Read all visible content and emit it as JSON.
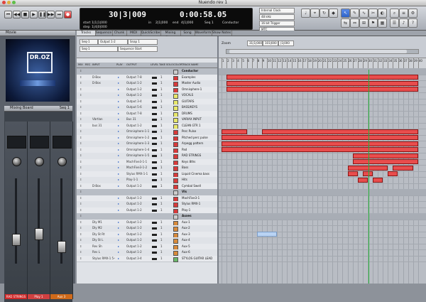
{
  "window": {
    "title": "Nuendo rev 1"
  },
  "transport": {
    "bars": "30|3|009",
    "time": "0:00:58.05",
    "start_label": "start",
    "start_value": "1|1|1|000",
    "step_label": "step",
    "step_value": "1|4|0|000",
    "in_label": "in",
    "in_value": "2|1|000",
    "end_label": "end",
    "end_value": "4|1|000",
    "tempo_label": "Seq 1",
    "conductor": "Conductor",
    "sync_options": [
      "Internal Clock",
      "48 kHz",
      "16 bit Trigger",
      "MTC"
    ]
  },
  "left": {
    "panel_title": "Movie",
    "logo_text": "DR.OZ",
    "mixer_title": "Mixing Board",
    "mixer_sel": "Seq 1",
    "channels": [
      {
        "name": "RAD STRINGS",
        "color": "#d02a2a"
      },
      {
        "name": "Play 1",
        "color": "#d04040"
      },
      {
        "name": "Aux 3",
        "color": "#d06a1a"
      }
    ]
  },
  "tabs": [
    "Tracks",
    "Sequence",
    "Chunk",
    "MIDI",
    "QuickScribe",
    "Mixing Board",
    "Song",
    "Waveform",
    "Show Notes"
  ],
  "tracklist": {
    "sequence_selector": "Seq-1",
    "track_filter": "Output 1-2",
    "snap": "Snap 1",
    "sequence_start": "Sequence Start",
    "columns": [
      "MIX",
      "REC",
      "INPUT",
      "PLAY",
      "OUTPUT",
      "LEVEL",
      "TAKE",
      "SOLO",
      "COLOR",
      "TRACK NAME"
    ],
    "rows": [
      {
        "input": "",
        "output": "",
        "name": "Conductor",
        "color": "#cccccc"
      },
      {
        "input": "D-Box",
        "output": "Output 7-8",
        "name": "Examples",
        "color": "#d83a3a"
      },
      {
        "input": "D-Box",
        "output": "Output 1-2",
        "name": "Master Audio",
        "color": "#d83a3a"
      },
      {
        "input": "",
        "output": "Output 1-2",
        "name": "Omnisphere-1",
        "color": "#d83a3a"
      },
      {
        "input": "",
        "output": "Output 1-2",
        "name": "VOCALS",
        "color": "#e8e86a"
      },
      {
        "input": "",
        "output": "Output 3-4",
        "name": "GUITARS",
        "color": "#e8e86a"
      },
      {
        "input": "",
        "output": "Output 5-6",
        "name": "BASS/KEYS",
        "color": "#e8e86a"
      },
      {
        "input": "",
        "output": "Output 7-8",
        "name": "DRUMS",
        "color": "#e8e86a"
      },
      {
        "input": "Vbrtlan",
        "output": "Bus 31",
        "name": "VARIAX INPUT",
        "color": "#e8e86a"
      },
      {
        "input": "bus 31",
        "output": "Output 1-2",
        "name": "CLEAN GTR 1",
        "color": "#e8e86a"
      },
      {
        "input": "",
        "output": "Omnisphere-1-1",
        "name": "Perc Pulse",
        "color": "#d83a3a"
      },
      {
        "input": "",
        "output": "Omnisphere-1-2",
        "name": "Pitched perc pulse",
        "color": "#d83a3a"
      },
      {
        "input": "",
        "output": "Omnisphere-1-3",
        "name": "Arpegg pattern",
        "color": "#d83a3a"
      },
      {
        "input": "",
        "output": "Omnisphere-1-4",
        "name": "Pad",
        "color": "#d83a3a"
      },
      {
        "input": "",
        "output": "Omnisphere-1-5",
        "name": "RAD STRINGS",
        "color": "#d83a3a"
      },
      {
        "input": "",
        "output": "MachFive3-1-1",
        "name": "Keys 8ths",
        "color": "#d83a3a"
      },
      {
        "input": "",
        "output": "MachFive3-1-2",
        "name": "Bass",
        "color": "#d83a3a"
      },
      {
        "input": "",
        "output": "Stylus RMX-1-1",
        "name": "Liquid Cinema bass",
        "color": "#d83a3a"
      },
      {
        "input": "",
        "output": "Play-1-1",
        "name": "Hits",
        "color": "#d83a3a"
      },
      {
        "input": "D-Box",
        "output": "Output 1-2",
        "name": "Cymbal Swell",
        "color": "#d83a3a"
      },
      {
        "input": "",
        "output": "",
        "name": "VIs",
        "color": "#cccccc"
      },
      {
        "input": "",
        "output": "Output 1-2",
        "name": "MachFive3-1",
        "color": "#d83a3a"
      },
      {
        "input": "",
        "output": "Output 1-2",
        "name": "Stylus RMX-1",
        "color": "#d83a3a"
      },
      {
        "input": "",
        "output": "Output 1-2",
        "name": "Play-1",
        "color": "#d83a3a"
      },
      {
        "input": "",
        "output": "",
        "name": "Auxes",
        "color": "#cccccc"
      },
      {
        "input": "Dly M1",
        "output": "Output 1-2",
        "name": "Aux-1",
        "color": "#d88a3a"
      },
      {
        "input": "Dly M2",
        "output": "Output 1-2",
        "name": "Aux-2",
        "color": "#d88a3a"
      },
      {
        "input": "Dly St Rt",
        "output": "Output 1-2",
        "name": "Aux-3",
        "color": "#d88a3a"
      },
      {
        "input": "Dly St L",
        "output": "Output 1-2",
        "name": "Aux-4",
        "color": "#d88a3a"
      },
      {
        "input": "Rev Sh",
        "output": "Output 1-2",
        "name": "Aux-5",
        "color": "#d88a3a"
      },
      {
        "input": "Rev L",
        "output": "Output 1-2",
        "name": "Aux-6",
        "color": "#d88a3a"
      },
      {
        "input": "Stylus RMX-1 5-6",
        "output": "Output 3-4",
        "name": "STYLOS GUITAR LEAD",
        "color": "#6ab86a"
      }
    ]
  },
  "arrange": {
    "zoom": "Zoom",
    "cursor_field": "31|1|000",
    "len_field": "101|000",
    "end_field": "|1|000",
    "ruler_labels": [
      "1",
      "2",
      "3",
      "4",
      "5",
      "6",
      "7",
      "8",
      "9",
      "10",
      "11",
      "12",
      "13",
      "14",
      "15",
      "16",
      "17",
      "18",
      "19",
      "20",
      "21",
      "22",
      "23",
      "24",
      "25",
      "26",
      "27",
      "28",
      "29",
      "30",
      "31",
      "32",
      "33",
      "34",
      "35",
      "36",
      "37",
      "38",
      "39",
      "40"
    ]
  },
  "colors": {
    "part": "#e84d4d",
    "cursor": "#27b33a",
    "accent": "#2f63c7"
  }
}
